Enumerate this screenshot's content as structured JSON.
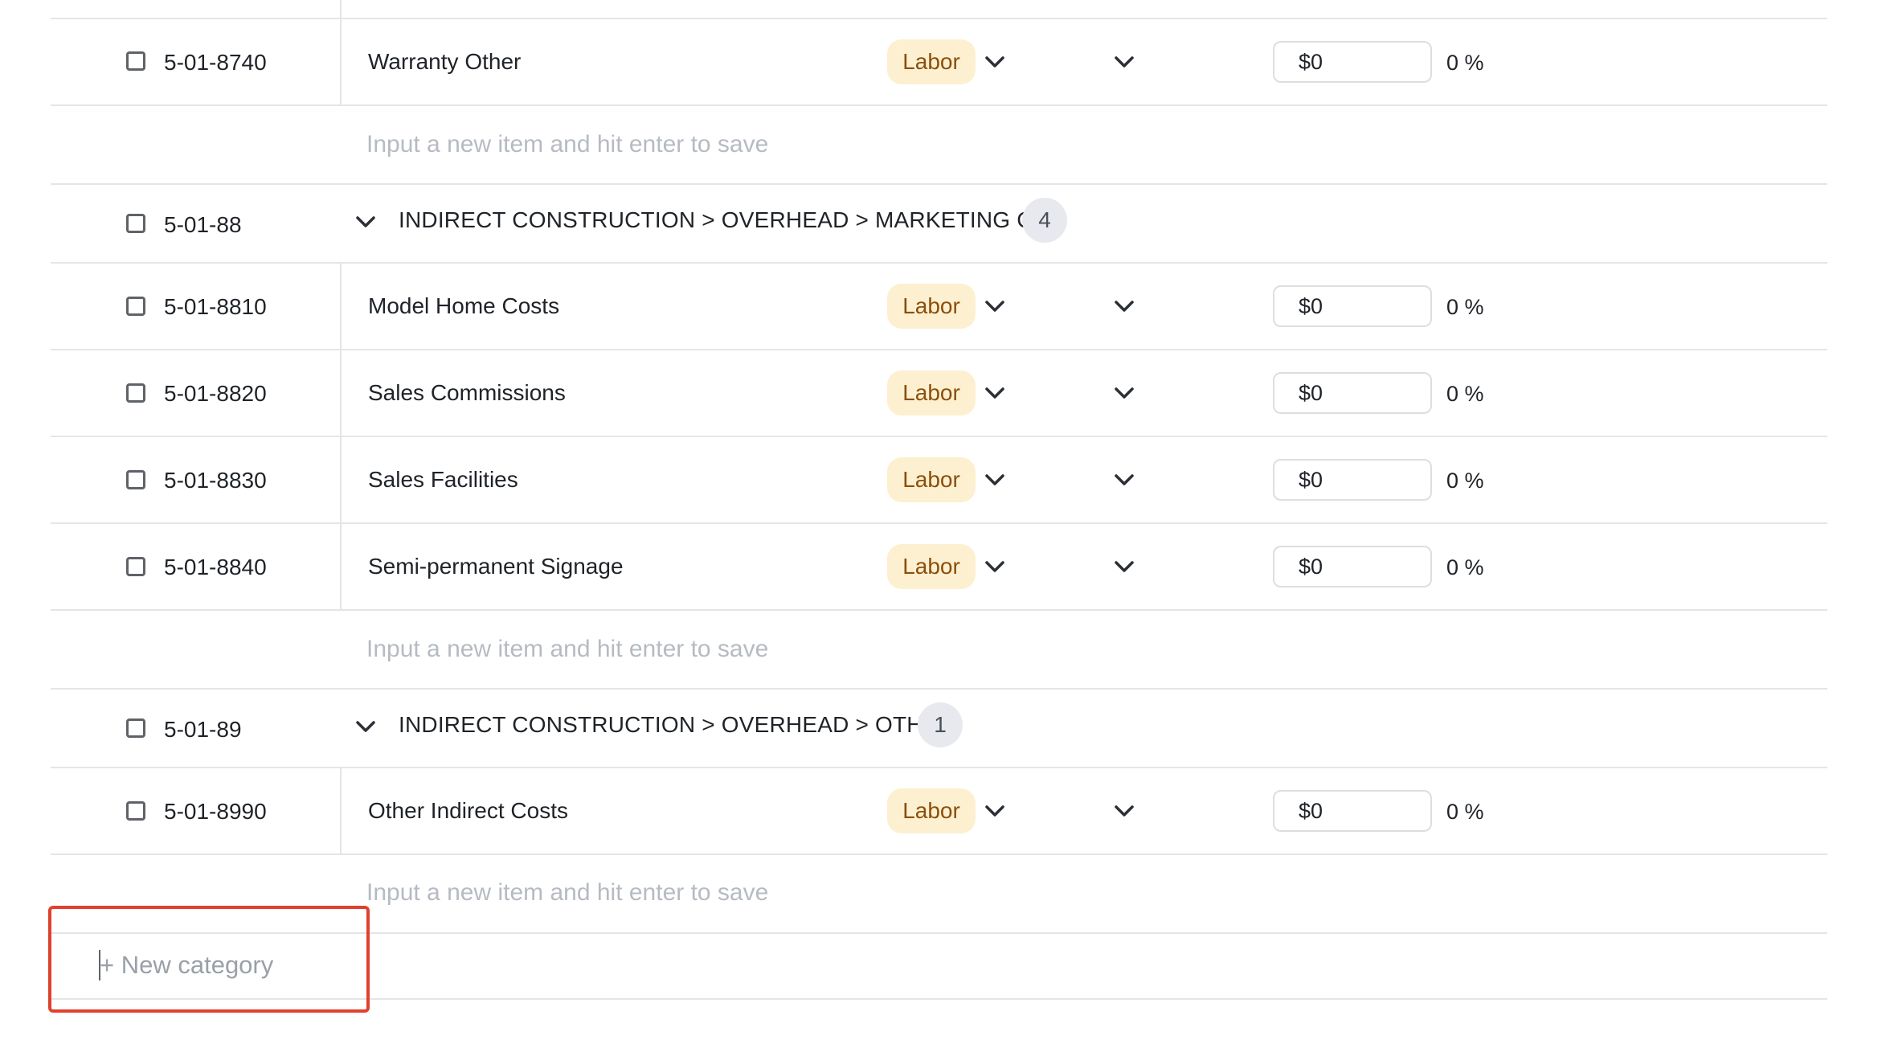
{
  "placeholder": "Input a new item and hit enter to save",
  "new_category_label": "+ New category",
  "colors": {
    "accent_outline": "#e0412e",
    "pill_bg": "#fdf0d1",
    "pill_text": "#8a4f0c"
  },
  "rows": [
    {
      "code": "5-01-8740",
      "name": "Warranty Other",
      "type": "Labor",
      "amount": "$0",
      "percent": "0 %"
    },
    {
      "code": "5-01-8810",
      "name": "Model Home Costs",
      "type": "Labor",
      "amount": "$0",
      "percent": "0 %"
    },
    {
      "code": "5-01-8820",
      "name": "Sales Commissions",
      "type": "Labor",
      "amount": "$0",
      "percent": "0 %"
    },
    {
      "code": "5-01-8830",
      "name": "Sales Facilities",
      "type": "Labor",
      "amount": "$0",
      "percent": "0 %"
    },
    {
      "code": "5-01-8840",
      "name": "Semi-permanent Signage",
      "type": "Labor",
      "amount": "$0",
      "percent": "0 %"
    },
    {
      "code": "5-01-8990",
      "name": "Other Indirect Costs",
      "type": "Labor",
      "amount": "$0",
      "percent": "0 %"
    }
  ],
  "categories": [
    {
      "code": "5-01-88",
      "path": "INDIRECT CONSTRUCTION > OVERHEAD > MARKETING C...",
      "count": "4"
    },
    {
      "code": "5-01-89",
      "path": "INDIRECT CONSTRUCTION > OVERHEAD > OTHER",
      "count": "1"
    }
  ]
}
